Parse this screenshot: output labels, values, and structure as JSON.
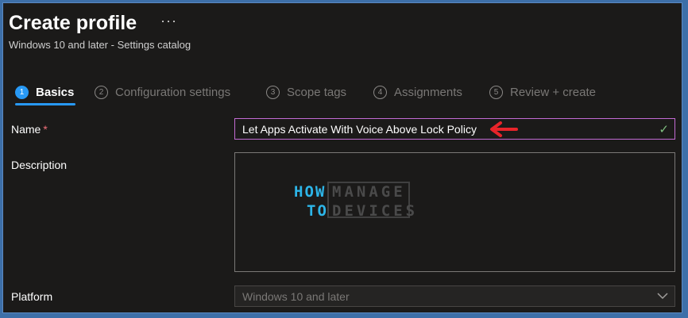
{
  "header": {
    "title": "Create profile",
    "more": "···",
    "subtitle": "Windows 10 and later - Settings catalog"
  },
  "steps": [
    {
      "num": "1",
      "label": "Basics",
      "active": true
    },
    {
      "num": "2",
      "label": "Configuration settings"
    },
    {
      "num": "3",
      "label": "Scope tags"
    },
    {
      "num": "4",
      "label": "Assignments"
    },
    {
      "num": "5",
      "label": "Review + create"
    }
  ],
  "form": {
    "name_label": "Name",
    "required_mark": "*",
    "name_value": "Let Apps Activate With Voice Above Lock Policy",
    "description_label": "Description",
    "description_value": "",
    "platform_label": "Platform",
    "platform_value": "Windows 10 and later"
  },
  "watermark": {
    "how": "HOW",
    "to": "TO",
    "manage": "MANAGE",
    "devices": "DEVICES"
  },
  "colors": {
    "accent": "#2899f5",
    "input_focus_border": "#c36bd4",
    "annotation_arrow": "#e8242a",
    "valid_check": "#7fbf7f"
  }
}
